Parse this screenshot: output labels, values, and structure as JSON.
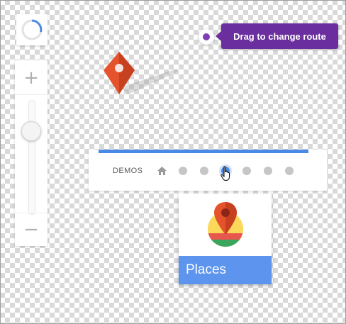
{
  "tooltip": {
    "text": "Drag to change route"
  },
  "zoom": {
    "in_label": "+",
    "out_label": "−"
  },
  "demos": {
    "label": "DEMOS",
    "items": [
      {
        "name": "demo-1",
        "active": false
      },
      {
        "name": "demo-2",
        "active": false
      },
      {
        "name": "demo-3",
        "active": true
      },
      {
        "name": "demo-4",
        "active": false
      },
      {
        "name": "demo-5",
        "active": false
      },
      {
        "name": "demo-6",
        "active": false
      }
    ]
  },
  "card": {
    "title": "Places",
    "icon": "places-pin-icon"
  },
  "colors": {
    "accent_blue": "#4a8ae6",
    "tooltip_purple": "#6a2e9e",
    "marker_red": "#e5532d",
    "card_caption": "#5c94ee"
  },
  "icons": [
    "spinner-icon",
    "home-icon",
    "marker-icon",
    "pointer-cursor-icon",
    "places-pin-icon"
  ]
}
